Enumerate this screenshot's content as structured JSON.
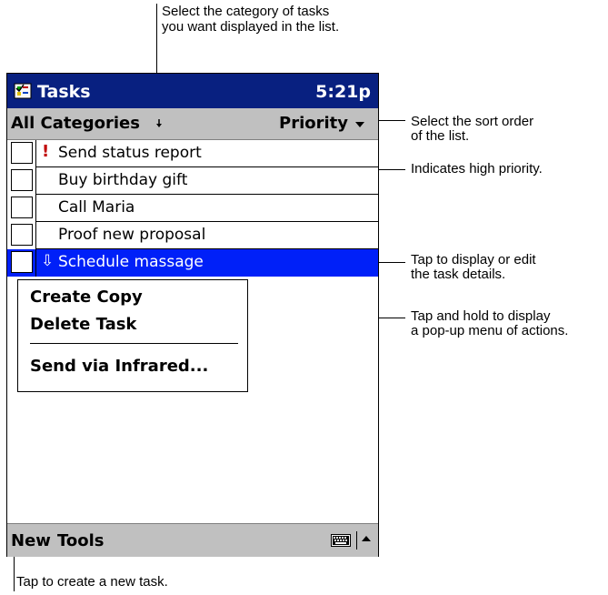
{
  "annotations": {
    "category_line1": "Select the category of tasks",
    "category_line2": "you want displayed in the list.",
    "sort_line1": "Select the sort order",
    "sort_line2": "of the list.",
    "priority": "Indicates high priority.",
    "details_line1": "Tap to display or edit",
    "details_line2": "the task details.",
    "popup_line1": "Tap and hold to display",
    "popup_line2": "a pop-up menu of actions.",
    "new_task": "Tap to create a new task."
  },
  "titlebar": {
    "title": "Tasks",
    "time": "5:21p",
    "icon": "tasks-app-icon"
  },
  "toolbar": {
    "category": "All Categories",
    "sort": "Priority",
    "icon": "chevron-down-icon"
  },
  "tasks": [
    {
      "label": "Send status report",
      "priority": "high",
      "marker": "!",
      "selected": false
    },
    {
      "label": "Buy birthday gift",
      "priority": "normal",
      "marker": "",
      "selected": false
    },
    {
      "label": "Call Maria",
      "priority": "normal",
      "marker": "",
      "selected": false
    },
    {
      "label": "Proof new proposal",
      "priority": "normal",
      "marker": "",
      "selected": false
    },
    {
      "label": "Schedule massage",
      "priority": "low",
      "marker": "⇩",
      "selected": true
    }
  ],
  "popup_menu": {
    "items": [
      "Create Copy",
      "Delete Task",
      "Send via Infrared..."
    ]
  },
  "command_bar": {
    "new": "New",
    "tools": "Tools",
    "icons": [
      "keyboard-icon",
      "chevron-up-icon"
    ]
  },
  "colors": {
    "titlebar": "#082080",
    "selection": "#0020f8",
    "bars": "#c0c0c0",
    "high_priority": "#c00000"
  }
}
